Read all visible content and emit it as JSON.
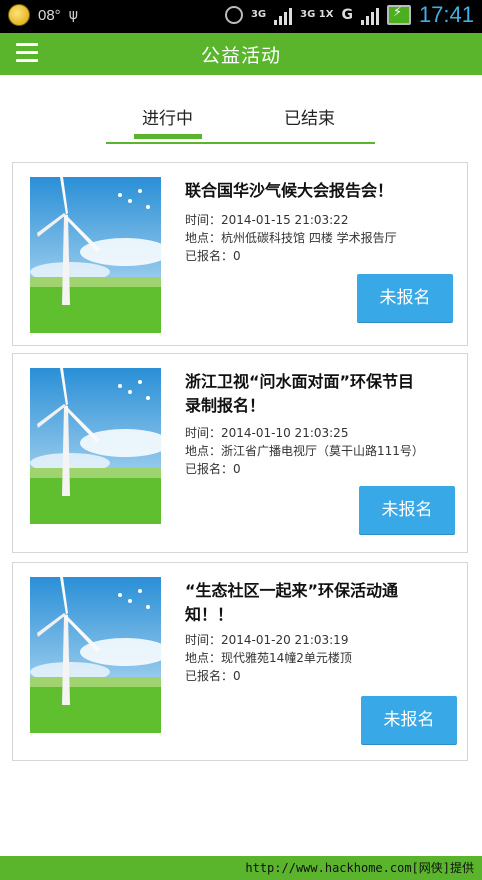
{
  "status_bar": {
    "temperature": "08°",
    "time": "17:41",
    "network_a": "3G",
    "network_b": "3G 1X",
    "signal_label": "G"
  },
  "header": {
    "title": "公益活动",
    "menu_icon": "menu-icon"
  },
  "tabs": [
    {
      "label": "进行中",
      "active": true
    },
    {
      "label": "已结束",
      "active": false
    }
  ],
  "events": [
    {
      "title_line1": "联合国华沙气候大会报告会！",
      "title_line2": "",
      "time": "时间：2014-01-15 21:03:22",
      "location": "地点：杭州低碳科技馆 四楼 学术报告厅",
      "signed": "已报名：0",
      "button": "未报名"
    },
    {
      "title_line1": "浙江卫视“问水面对面”环保节目",
      "title_line2": "录制报名！",
      "time": "时间：2014-01-10 21:03:25",
      "location": "地点：浙江省广播电视厅（莫干山路111号）",
      "signed": "已报名：0",
      "button": "未报名"
    },
    {
      "title_line1": "“生态社区一起来”环保活动通",
      "title_line2": "知！！",
      "time": "时间：2014-01-20 21:03:19",
      "location": "地点：现代雅苑14幢2单元楼顶",
      "signed": "已报名：0",
      "button": "未报名"
    }
  ],
  "footer": {
    "watermark": "http://www.hackhome.com[网侠]提供"
  },
  "colors": {
    "brand_green": "#5ab52d",
    "button_blue": "#39a8e6"
  }
}
